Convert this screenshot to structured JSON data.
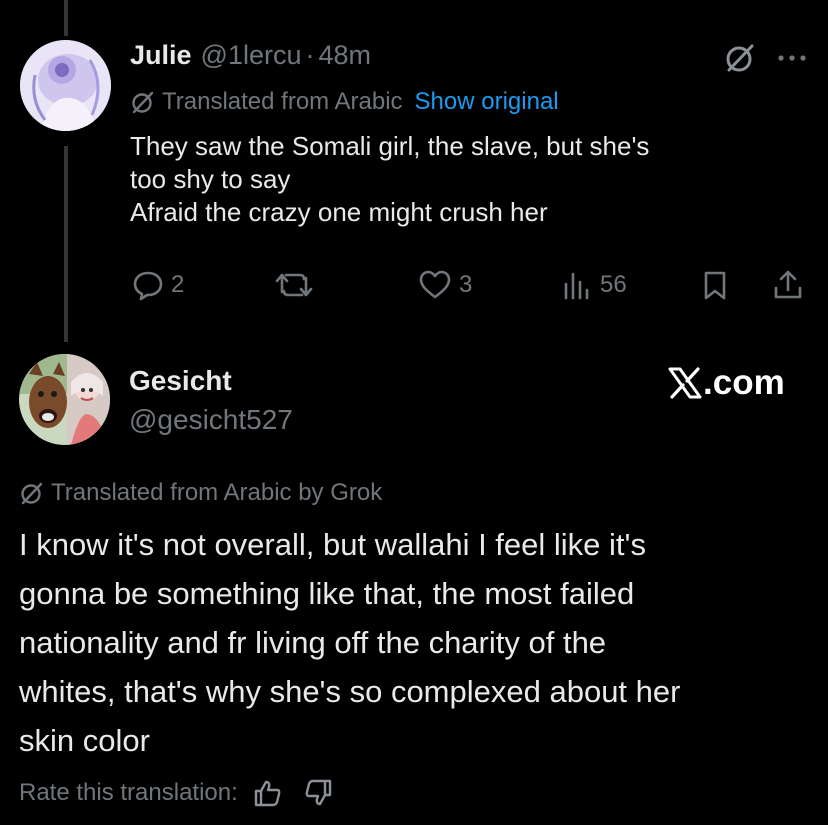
{
  "reply": {
    "name": "Julie",
    "handle": "@1lercu",
    "separator": "·",
    "time": "48m",
    "translated_label": "Translated from Arabic",
    "show_original": "Show original",
    "text_lines": [
      "They saw the Somali girl, the slave, but she's",
      "too shy to say",
      "Afraid the crazy one might crush her"
    ],
    "actions": {
      "replies": "2",
      "reposts": "",
      "likes": "3",
      "views": "56"
    },
    "icons": [
      "grok-icon",
      "more-icon",
      "reply-icon",
      "repost-icon",
      "like-icon",
      "views-icon",
      "bookmark-icon",
      "share-icon"
    ]
  },
  "quoted": {
    "name": "Gesicht",
    "handle": "@gesicht527",
    "brand": "X.com",
    "translated_label": "Translated from Arabic by Grok",
    "text_lines": [
      "I know it's not overall, but wallahi I feel like it's",
      "gonna be something like that, the most failed",
      "nationality and fr living off the charity of the",
      "whites, that's why she's so complexed about her",
      "skin color"
    ],
    "rate_label": "Rate this translation:",
    "icons": [
      "thumbs-up-icon",
      "thumbs-down-icon"
    ]
  },
  "colors": {
    "background": "#000000",
    "text": "#e7e9ea",
    "muted": "#71767b",
    "link": "#1d9bf0",
    "thread_line": "#333639"
  }
}
